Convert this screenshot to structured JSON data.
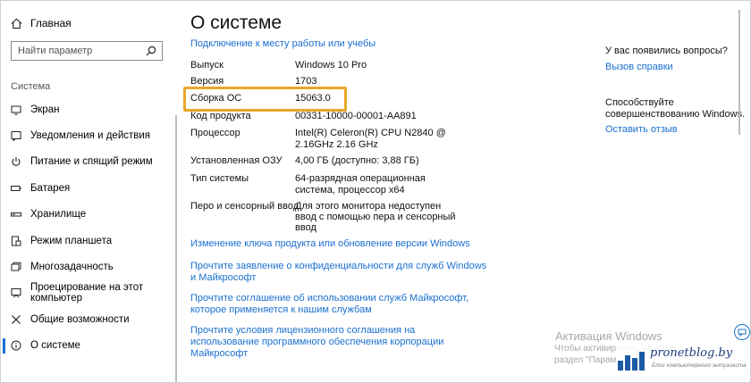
{
  "sidebar": {
    "home_label": "Главная",
    "search_placeholder": "Найти параметр",
    "section_label": "Система",
    "items": [
      {
        "label": "Экран",
        "icon": "monitor-icon"
      },
      {
        "label": "Уведомления и действия",
        "icon": "notification-icon"
      },
      {
        "label": "Питание и спящий режим",
        "icon": "power-icon"
      },
      {
        "label": "Батарея",
        "icon": "battery-icon"
      },
      {
        "label": "Хранилище",
        "icon": "storage-icon"
      },
      {
        "label": "Режим планшета",
        "icon": "tablet-icon"
      },
      {
        "label": "Многозадачность",
        "icon": "multitasking-icon"
      },
      {
        "label": "Проецирование на этот компьютер",
        "icon": "projecting-icon"
      },
      {
        "label": "Общие возможности",
        "icon": "shared-experiences-icon"
      },
      {
        "label": "О системе",
        "icon": "info-icon",
        "active": true
      }
    ]
  },
  "main": {
    "title": "О системе",
    "connect_link": "Подключение к месту работы или учебы",
    "specs": {
      "edition": {
        "label": "Выпуск",
        "value": "Windows 10 Pro"
      },
      "version": {
        "label": "Версия",
        "value": "1703"
      },
      "build": {
        "label": "Сборка ОС",
        "value": "15063.0"
      },
      "product_id": {
        "label": "Код продукта",
        "value": "00331-10000-00001-AA891"
      },
      "processor": {
        "label": "Процессор",
        "value_line1": "Intel(R) Celeron(R) CPU  N2840  @",
        "value_line2": "2.16GHz   2.16 GHz"
      },
      "ram": {
        "label": "Установленная ОЗУ",
        "value": "4,00 ГБ (доступно: 3,88 ГБ)"
      },
      "system_type": {
        "label": "Тип системы",
        "value_line1": "64-разрядная операционная",
        "value_line2": "система, процессор x64"
      },
      "pen_touch": {
        "label": "Перо и сенсорный ввод",
        "value_line1": "Для этого монитора недоступен",
        "value_line2": "ввод с помощью пера и сенсорный",
        "value_line3": "ввод"
      }
    },
    "links": {
      "change_key": "Изменение ключа продукта или обновление версии Windows",
      "privacy_line1": "Прочтите заявление о конфиденциальности для служб Windows",
      "privacy_line2": "и Майкрософт",
      "services_line1": "Прочтите соглашение об использовании служб Майкрософт,",
      "services_line2": "которое применяется к нашим службам",
      "license_line1": "Прочтите условия лицензионного соглашения на",
      "license_line2": "использование программного обеспечения корпорации",
      "license_line3": "Майкрософт"
    }
  },
  "right": {
    "questions": "У вас появились вопросы?",
    "help_link": "Вызов справки",
    "improve_line1": "Способствуйте",
    "improve_line2": "совершенствованию Windows.",
    "feedback_link": "Оставить отзыв"
  },
  "watermark": {
    "title": "Активация Windows",
    "line1": "Чтобы активировать Windows,",
    "line2": "раздел \"Парам"
  },
  "brand": {
    "name": "pronetblog.by",
    "tagline": "Блог компьютерного энтузиаста"
  },
  "colors": {
    "link": "#1a6fd0",
    "highlight": "#e8a62a",
    "text": "#111111"
  }
}
